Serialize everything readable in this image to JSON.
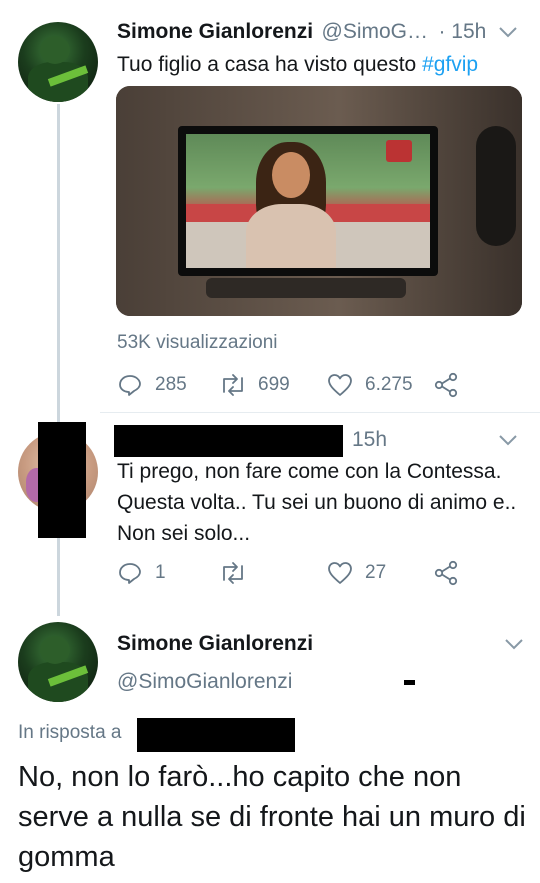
{
  "tweet1": {
    "name": "Simone Gianlorenzi",
    "handle": "@SimoG…",
    "time": "· 15h",
    "text_before": "Tuo figlio a casa ha visto questo ",
    "hashtag": "#gfvip",
    "views": "53K visualizzazioni",
    "replies": "285",
    "retweets": "699",
    "likes": "6.275"
  },
  "tweet2": {
    "time": "15h",
    "text": "Ti prego, non fare come con la Contessa. Questa volta.. Tu sei un buono di animo e.. Non sei solo...",
    "replies": "1",
    "retweets": "",
    "likes": "27"
  },
  "tweet3": {
    "name": "Simone Gianlorenzi",
    "handle": "@SimoGianlorenzi",
    "reply_prefix": "In risposta a",
    "text": "No, non lo farò...ho capito che non serve a nulla se di fronte hai un muro di gomma"
  },
  "colors": {
    "text": "#14171a",
    "muted": "#657786",
    "link": "#1da1f2",
    "thread_line": "#ccd6dd"
  },
  "icons": [
    "chevron-down-icon",
    "reply-icon",
    "retweet-icon",
    "like-icon",
    "share-icon"
  ]
}
